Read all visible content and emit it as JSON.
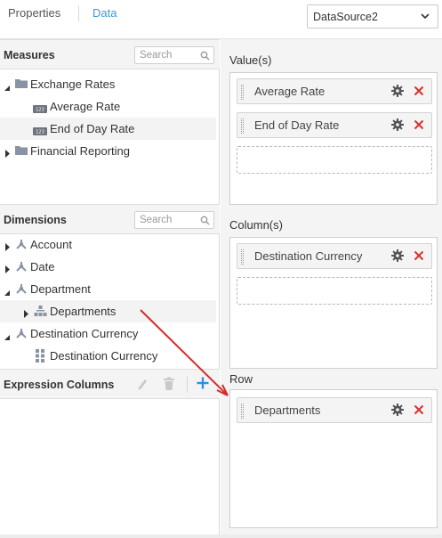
{
  "tabs": {
    "properties": "Properties",
    "data": "Data"
  },
  "datasource": {
    "selected": "DataSource2"
  },
  "measures": {
    "title": "Measures",
    "search_placeholder": "Search",
    "groups": [
      {
        "label": "Exchange Rates",
        "items": [
          "Average Rate",
          "End of Day Rate"
        ]
      },
      {
        "label": "Financial Reporting"
      }
    ]
  },
  "dimensions": {
    "title": "Dimensions",
    "search_placeholder": "Search",
    "items": [
      {
        "label": "Account"
      },
      {
        "label": "Date"
      },
      {
        "label": "Department",
        "children": [
          {
            "label": "Departments"
          }
        ]
      },
      {
        "label": "Destination Currency",
        "children": [
          {
            "label": "Destination Currency"
          }
        ]
      }
    ]
  },
  "expression_columns": {
    "title": "Expression Columns"
  },
  "values_section": {
    "label": "Value(s)",
    "items": [
      "Average Rate",
      "End of Day Rate"
    ]
  },
  "columns_section": {
    "label": "Column(s)",
    "items": [
      "Destination Currency"
    ]
  },
  "row_section": {
    "label": "Row",
    "items": [
      "Departments"
    ]
  },
  "colors": {
    "accent": "#3a9ad9",
    "remove": "#d9312b",
    "drag_arrow": "#d62b2b"
  },
  "icons": [
    "chevron-down-icon",
    "search-icon",
    "folder-icon",
    "measure-icon",
    "dimension-icon",
    "hierarchy-icon",
    "level-icon",
    "edit-icon",
    "delete-icon",
    "add-icon",
    "gear-icon",
    "close-icon",
    "drag-arrow"
  ]
}
